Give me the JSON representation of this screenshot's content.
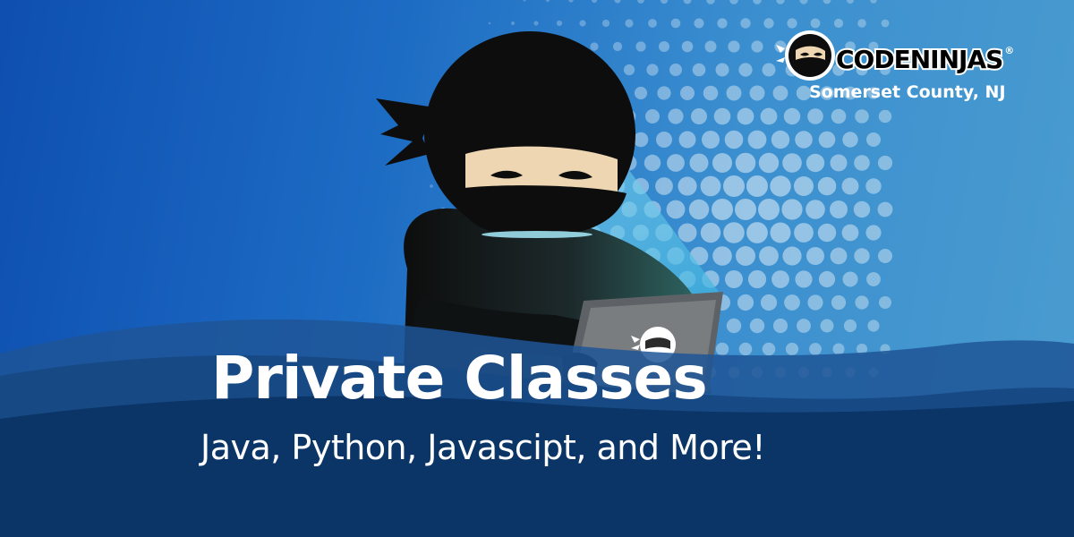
{
  "brand": {
    "wordmark_part1": "CODE",
    "wordmark_part2": "NINJAS",
    "registered_mark": "®",
    "location": "Somerset County, NJ"
  },
  "headline": {
    "title": "Private Classes",
    "subtitle": "Java, Python, Javascipt, and More!"
  },
  "colors": {
    "background_top_left": "#0e4fb0",
    "background_right": "#4a9ccf",
    "wave_dark": "#0b3566",
    "wave_mid": "#1d4d82",
    "ninja_black": "#0d0d0d",
    "ninja_skin": "#eed6b3",
    "laptop_gray": "#7a7a7a",
    "text_white": "#ffffff"
  },
  "icons": {
    "logo_mark": "ninja-head-icon",
    "laptop_logo": "ninja-head-icon",
    "illustration": "ninja-with-laptop"
  }
}
